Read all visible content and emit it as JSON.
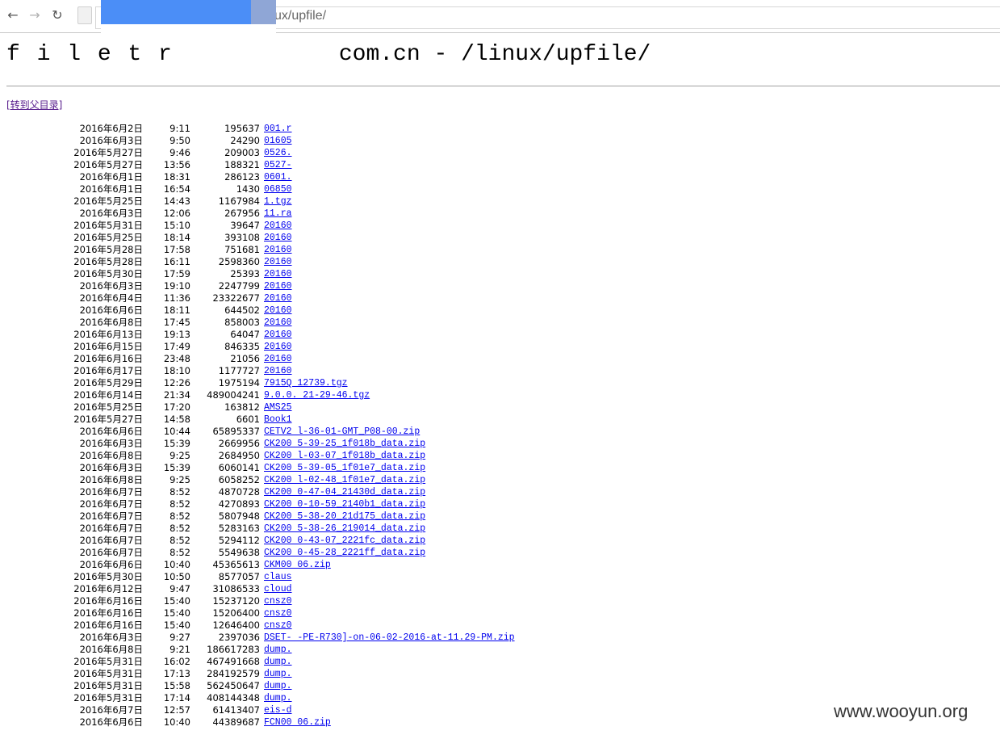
{
  "browser": {
    "address_text": "ux/upfile/",
    "back_icon": "←",
    "forward_icon": "→",
    "reload_icon": "↻"
  },
  "page": {
    "title_prefix": "f i l e t r",
    "title_main": "com.cn - /linux/upfile/",
    "parent_link": "[转到父目录]"
  },
  "files": [
    {
      "date": "2016年6月2日",
      "time": "9:11",
      "size": "195637",
      "name": "001.r"
    },
    {
      "date": "2016年6月3日",
      "time": "9:50",
      "size": "24290",
      "name": "01605"
    },
    {
      "date": "2016年5月27日",
      "time": "9:46",
      "size": "209003",
      "name": "0526."
    },
    {
      "date": "2016年5月27日",
      "time": "13:56",
      "size": "188321",
      "name": "0527-"
    },
    {
      "date": "2016年6月1日",
      "time": "18:31",
      "size": "286123",
      "name": "0601."
    },
    {
      "date": "2016年6月1日",
      "time": "16:54",
      "size": "1430",
      "name": "06850"
    },
    {
      "date": "2016年5月25日",
      "time": "14:43",
      "size": "1167984",
      "name": "1.tgz"
    },
    {
      "date": "2016年6月3日",
      "time": "12:06",
      "size": "267956",
      "name": "11.ra"
    },
    {
      "date": "2016年5月31日",
      "time": "15:10",
      "size": "39647",
      "name": "20160"
    },
    {
      "date": "2016年5月25日",
      "time": "18:14",
      "size": "393108",
      "name": "20160"
    },
    {
      "date": "2016年5月28日",
      "time": "17:58",
      "size": "751681",
      "name": "20160"
    },
    {
      "date": "2016年5月28日",
      "time": "16:11",
      "size": "2598360",
      "name": "20160"
    },
    {
      "date": "2016年5月30日",
      "time": "17:59",
      "size": "25393",
      "name": "20160"
    },
    {
      "date": "2016年6月3日",
      "time": "19:10",
      "size": "2247799",
      "name": "20160"
    },
    {
      "date": "2016年6月4日",
      "time": "11:36",
      "size": "23322677",
      "name": "20160"
    },
    {
      "date": "2016年6月6日",
      "time": "18:11",
      "size": "644502",
      "name": "20160"
    },
    {
      "date": "2016年6月8日",
      "time": "17:45",
      "size": "858003",
      "name": "20160"
    },
    {
      "date": "2016年6月13日",
      "time": "19:13",
      "size": "64047",
      "name": "20160"
    },
    {
      "date": "2016年6月15日",
      "time": "17:49",
      "size": "846335",
      "name": "20160"
    },
    {
      "date": "2016年6月16日",
      "time": "23:48",
      "size": "21056",
      "name": "20160"
    },
    {
      "date": "2016年6月17日",
      "time": "18:10",
      "size": "1177727",
      "name": "20160"
    },
    {
      "date": "2016年5月29日",
      "time": "12:26",
      "size": "1975194",
      "name": "7915Q        12739.tgz"
    },
    {
      "date": "2016年6月14日",
      "time": "21:34",
      "size": "489004241",
      "name": "9.0.0.       21-29-46.tgz"
    },
    {
      "date": "2016年5月25日",
      "time": "17:20",
      "size": "163812",
      "name": "AMS25"
    },
    {
      "date": "2016年5月27日",
      "time": "14:58",
      "size": "6601",
      "name": "Book1"
    },
    {
      "date": "2016年6月6日",
      "time": "10:44",
      "size": "65895337",
      "name": "CETV2       l-36-01-GMT_P08-00.zip"
    },
    {
      "date": "2016年6月3日",
      "time": "15:39",
      "size": "2669956",
      "name": "CK200       5-39-25_1f018b_data.zip"
    },
    {
      "date": "2016年6月8日",
      "time": "9:25",
      "size": "2684950",
      "name": "CK200       l-03-07_1f018b_data.zip"
    },
    {
      "date": "2016年6月3日",
      "time": "15:39",
      "size": "6060141",
      "name": "CK200       5-39-05_1f01e7_data.zip"
    },
    {
      "date": "2016年6月8日",
      "time": "9:25",
      "size": "6058252",
      "name": "CK200       l-02-48_1f01e7_data.zip"
    },
    {
      "date": "2016年6月7日",
      "time": "8:52",
      "size": "4870728",
      "name": "CK200       0-47-04_21430d_data.zip"
    },
    {
      "date": "2016年6月7日",
      "time": "8:52",
      "size": "4270893",
      "name": "CK200       0-10-59_2140b1_data.zip"
    },
    {
      "date": "2016年6月7日",
      "time": "8:52",
      "size": "5807948",
      "name": "CK200       5-38-20_21d175_data.zip"
    },
    {
      "date": "2016年6月7日",
      "time": "8:52",
      "size": "5283163",
      "name": "CK200       5-38-26_219014_data.zip"
    },
    {
      "date": "2016年6月7日",
      "time": "8:52",
      "size": "5294112",
      "name": "CK200       0-43-07_2221fc_data.zip"
    },
    {
      "date": "2016年6月7日",
      "time": "8:52",
      "size": "5549638",
      "name": "CK200       0-45-28_2221ff_data.zip"
    },
    {
      "date": "2016年6月6日",
      "time": "10:40",
      "size": "45365613",
      "name": "CKM00       06.zip"
    },
    {
      "date": "2016年5月30日",
      "time": "10:50",
      "size": "8577057",
      "name": "claus"
    },
    {
      "date": "2016年6月12日",
      "time": "9:47",
      "size": "31086533",
      "name": "cloud"
    },
    {
      "date": "2016年6月16日",
      "time": "15:40",
      "size": "15237120",
      "name": "cnsz0"
    },
    {
      "date": "2016年6月16日",
      "time": "15:40",
      "size": "15206400",
      "name": "cnsz0"
    },
    {
      "date": "2016年6月16日",
      "time": "15:40",
      "size": "12646400",
      "name": "cnsz0"
    },
    {
      "date": "2016年6月3日",
      "time": "9:27",
      "size": "2397036",
      "name": "DSET-       -PE-R730]-on-06-02-2016-at-11.29-PM.zip"
    },
    {
      "date": "2016年6月8日",
      "time": "9:21",
      "size": "186617283",
      "name": "dump."
    },
    {
      "date": "2016年5月31日",
      "time": "16:02",
      "size": "467491668",
      "name": "dump."
    },
    {
      "date": "2016年5月31日",
      "time": "17:13",
      "size": "284192579",
      "name": "dump."
    },
    {
      "date": "2016年5月31日",
      "time": "15:58",
      "size": "562450647",
      "name": "dump."
    },
    {
      "date": "2016年5月31日",
      "time": "17:14",
      "size": "408144348",
      "name": "dump."
    },
    {
      "date": "2016年6月7日",
      "time": "12:57",
      "size": "61413407",
      "name": "eis-d"
    },
    {
      "date": "2016年6月6日",
      "time": "10:40",
      "size": "44389687",
      "name": "FCN00       06.zip"
    }
  ],
  "watermark": "www.wooyun.org"
}
